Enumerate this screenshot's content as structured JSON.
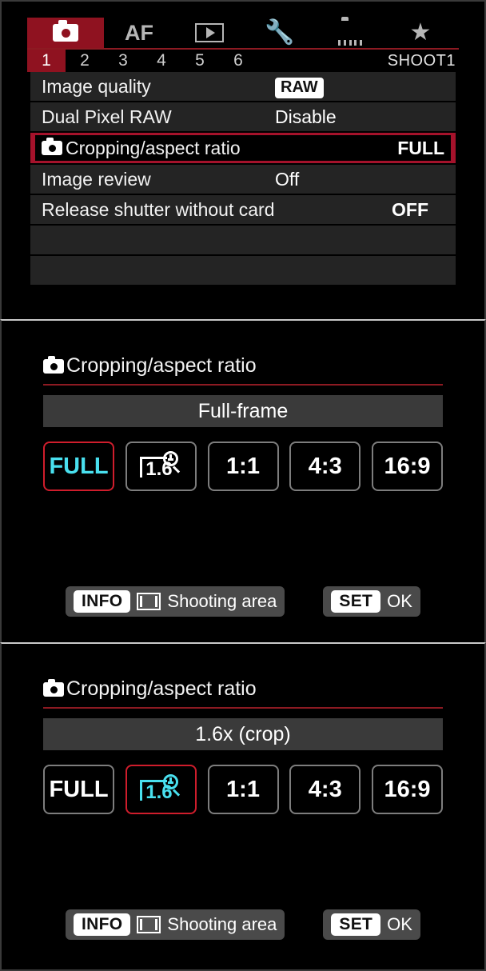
{
  "menu_screen": {
    "tabs": [
      {
        "name": "shooting",
        "icon": "camera-icon",
        "label": "",
        "active": true
      },
      {
        "name": "af",
        "icon": "af-text-icon",
        "label": "AF",
        "active": false
      },
      {
        "name": "playback",
        "icon": "playback-icon",
        "label": "",
        "active": false
      },
      {
        "name": "setup",
        "icon": "wrench-icon",
        "label": "",
        "active": false
      },
      {
        "name": "custom",
        "icon": "custom-camera-icon",
        "label": "",
        "active": false
      },
      {
        "name": "myMenu",
        "icon": "star-icon",
        "label": "",
        "active": false
      }
    ],
    "page_numbers": [
      "1",
      "2",
      "3",
      "4",
      "5",
      "6"
    ],
    "active_page": "1",
    "page_code": "SHOOT1",
    "rows": [
      {
        "label": "Image quality",
        "value": "RAW",
        "style": "badge",
        "selected": false,
        "camera_icon": false
      },
      {
        "label": "Dual Pixel RAW",
        "value": "Disable",
        "style": "plain",
        "selected": false,
        "camera_icon": false
      },
      {
        "label": "Cropping/aspect ratio",
        "value": "FULL",
        "style": "bold",
        "selected": true,
        "camera_icon": true
      },
      {
        "label": "Image review",
        "value": "Off",
        "style": "plain",
        "selected": false,
        "camera_icon": false
      },
      {
        "label": "Release shutter without card",
        "value": "OFF",
        "style": "bold",
        "selected": false,
        "camera_icon": false
      },
      {
        "label": "",
        "value": "",
        "style": "plain",
        "selected": false,
        "camera_icon": false
      },
      {
        "label": "",
        "value": "",
        "style": "plain",
        "selected": false,
        "camera_icon": false
      }
    ]
  },
  "detail_full": {
    "title": "Cropping/aspect ratio",
    "current_value": "Full-frame",
    "options": [
      {
        "label": "FULL",
        "icon": "",
        "selected": true
      },
      {
        "label": "",
        "icon": "crop-1.6-magnifier-icon",
        "icon_text": "1.6",
        "selected": false
      },
      {
        "label": "1:1",
        "icon": "",
        "selected": false
      },
      {
        "label": "4:3",
        "icon": "",
        "selected": false
      },
      {
        "label": "16:9",
        "icon": "",
        "selected": false
      }
    ],
    "guide": {
      "info_key": "INFO",
      "info_text": "Shooting area",
      "set_key": "SET",
      "set_text": "OK"
    }
  },
  "detail_crop": {
    "title": "Cropping/aspect ratio",
    "current_value": "1.6x (crop)",
    "options": [
      {
        "label": "FULL",
        "icon": "",
        "selected": false
      },
      {
        "label": "",
        "icon": "crop-1.6-magnifier-icon",
        "icon_text": "1.6",
        "selected": true
      },
      {
        "label": "1:1",
        "icon": "",
        "selected": false
      },
      {
        "label": "4:3",
        "icon": "",
        "selected": false
      },
      {
        "label": "16:9",
        "icon": "",
        "selected": false
      }
    ],
    "guide": {
      "info_key": "INFO",
      "info_text": "Shooting area",
      "set_key": "SET",
      "set_text": "OK"
    }
  },
  "colors": {
    "accent_red": "#a5122b",
    "tab_red": "#8f1220",
    "rule_red": "#8d1a22",
    "select_border_red": "#cf1d2c",
    "highlight_cyan": "#49e0ef",
    "row_gray": "#242424",
    "bar_gray": "#3a3a3a",
    "background": "#000000"
  }
}
